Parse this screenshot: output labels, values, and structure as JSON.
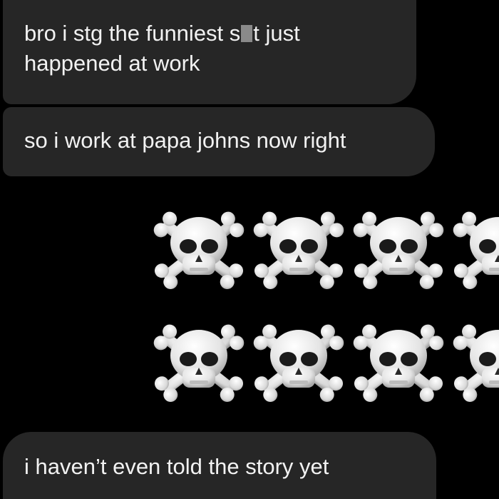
{
  "messages": [
    {
      "text_before": "bro i stg the funniest s",
      "text_after": "t just",
      "line2": "happened at work",
      "censored": true
    },
    {
      "text": "so i work at papa johns now right"
    },
    {
      "emoji": "skull-and-crossbones",
      "count": 8,
      "rows": 2,
      "per_row": 4
    },
    {
      "text": "i haven’t even told the story yet"
    }
  ],
  "colors": {
    "background": "#000000",
    "bubble": "#262626",
    "text": "#f2f2f2",
    "censor_block": "#8a8a8a"
  }
}
